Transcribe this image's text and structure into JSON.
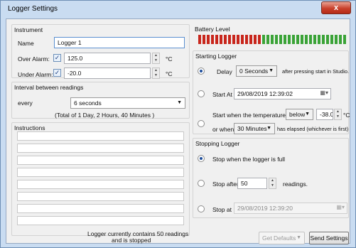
{
  "window": {
    "title": "Logger Settings",
    "close_label": "x"
  },
  "instrument": {
    "title": "Instrument",
    "name_label": "Name",
    "name_value": "Logger 1",
    "over_alarm_label": "Over Alarm:",
    "over_alarm_value": "125.0",
    "under_alarm_label": "Under Alarm:",
    "under_alarm_value": "-20.0",
    "unit": "°C",
    "check_mark": "✓"
  },
  "interval": {
    "title": "Interval between readings",
    "every_label": "every",
    "value": "6 seconds",
    "total": "(Total of 1 Day, 2 Hours, 40 Minutes )"
  },
  "instructions": {
    "title": "Instructions"
  },
  "battery": {
    "title": "Battery Level",
    "colors": {
      "red": "#c8261c",
      "green": "#3aa337"
    },
    "level": 0.42
  },
  "starting": {
    "title": "Starting Logger",
    "delay_label": "Delay",
    "delay_value": "0 Seconds",
    "delay_suffix": "after pressing start in Studio.",
    "start_at_label": "Start At",
    "start_at_value": "29/08/2019 12:39:02",
    "temp_label": "Start when the temperature is",
    "temp_condition": "below",
    "temp_value": "-38.0",
    "temp_unit": "°C",
    "or_when_label": "or when",
    "or_when_value": "30 Minutes",
    "elapsed_label": "has elapsed (whichever is first)"
  },
  "stopping": {
    "title": "Stopping Logger",
    "full_label": "Stop when the logger is full",
    "after_label": "Stop after",
    "after_value": "50",
    "after_suffix": "readings.",
    "at_label": "Stop at",
    "at_value": "29/08/2019 12:39:20"
  },
  "status": {
    "line1": "Logger currently contains 50 readings",
    "line2": "and is stopped"
  },
  "buttons": {
    "get_defaults": "Get Defaults",
    "send_settings": "Send Settings"
  },
  "icons": {
    "up": "▲",
    "down": "▼",
    "calendar": "▦▾"
  }
}
